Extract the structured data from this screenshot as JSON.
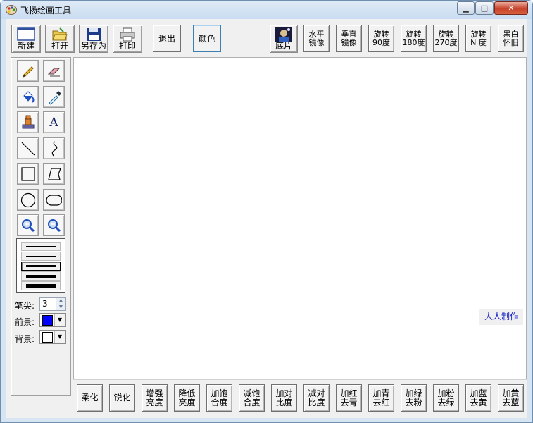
{
  "window": {
    "title": "飞扬绘画工具",
    "min": "▁",
    "max": "□",
    "close": "✕"
  },
  "toolbar_left": [
    {
      "name": "new-button",
      "label": "新建",
      "icon": "new-file-icon"
    },
    {
      "name": "open-button",
      "label": "打开",
      "icon": "folder-open-icon"
    },
    {
      "name": "save-as-button",
      "label": "另存为",
      "icon": "floppy-disk-icon"
    },
    {
      "name": "print-button",
      "label": "打印",
      "icon": "printer-icon"
    }
  ],
  "exit_label": "退出",
  "color_label": "颜色",
  "negative_label": "底片",
  "toolbar_right": [
    {
      "name": "flip-horizontal-button",
      "label": "水平\n镜像"
    },
    {
      "name": "flip-vertical-button",
      "label": "垂直\n镜像"
    },
    {
      "name": "rotate-90-button",
      "label": "旋转\n90度"
    },
    {
      "name": "rotate-180-button",
      "label": "旋转\n180度"
    },
    {
      "name": "rotate-270-button",
      "label": "旋转\n270度"
    },
    {
      "name": "rotate-n-button",
      "label": "旋转\nN 度"
    },
    {
      "name": "nostalgia-bw-button",
      "label": "黑白\n怀旧"
    }
  ],
  "tools": [
    {
      "name": "pencil-tool",
      "icon": "pencil-icon"
    },
    {
      "name": "eraser-tool",
      "icon": "eraser-icon"
    },
    {
      "name": "fill-tool",
      "icon": "paint-bucket-icon"
    },
    {
      "name": "color-picker-tool",
      "icon": "eyedropper-icon"
    },
    {
      "name": "stamp-tool",
      "icon": "stamp-icon"
    },
    {
      "name": "text-tool",
      "icon": "text-icon",
      "text": "A"
    },
    {
      "name": "line-tool",
      "icon": "line-icon"
    },
    {
      "name": "curve-tool",
      "icon": "curve-icon"
    },
    {
      "name": "rectangle-tool",
      "icon": "rectangle-icon"
    },
    {
      "name": "polygon-tool",
      "icon": "polygon-icon"
    },
    {
      "name": "ellipse-tool",
      "icon": "ellipse-icon"
    },
    {
      "name": "rounded-rect-tool",
      "icon": "rounded-rect-icon"
    },
    {
      "name": "zoom-in-tool",
      "icon": "zoom-in-icon"
    },
    {
      "name": "zoom-out-tool",
      "icon": "zoom-out-icon"
    }
  ],
  "line_widths": [
    1,
    2,
    3,
    4,
    5
  ],
  "brush": {
    "label": "笔尖:",
    "value": "3"
  },
  "foreground": {
    "label": "前景:",
    "color": "#0000ff"
  },
  "background": {
    "label": "背景:",
    "color": "#ffffff"
  },
  "author_label": "人人制作",
  "bottom_buttons": [
    {
      "name": "soften-button",
      "label": "柔化"
    },
    {
      "name": "sharpen-button",
      "label": "锐化"
    },
    {
      "name": "brightness-up-button",
      "label": "增强\n亮度"
    },
    {
      "name": "brightness-down-button",
      "label": "降低\n亮度"
    },
    {
      "name": "saturation-up-button",
      "label": "加饱\n合度"
    },
    {
      "name": "saturation-down-button",
      "label": "减饱\n合度"
    },
    {
      "name": "contrast-up-button",
      "label": "加对\n比度"
    },
    {
      "name": "contrast-down-button",
      "label": "减对\n比度"
    },
    {
      "name": "add-red-button",
      "label": "加红\n去青"
    },
    {
      "name": "add-cyan-button",
      "label": "加青\n去红"
    },
    {
      "name": "add-green-button",
      "label": "加绿\n去粉"
    },
    {
      "name": "add-magenta-button",
      "label": "加粉\n去绿"
    },
    {
      "name": "add-blue-button",
      "label": "加蓝\n去黄"
    },
    {
      "name": "add-yellow-button",
      "label": "加黄\n去蓝"
    }
  ]
}
